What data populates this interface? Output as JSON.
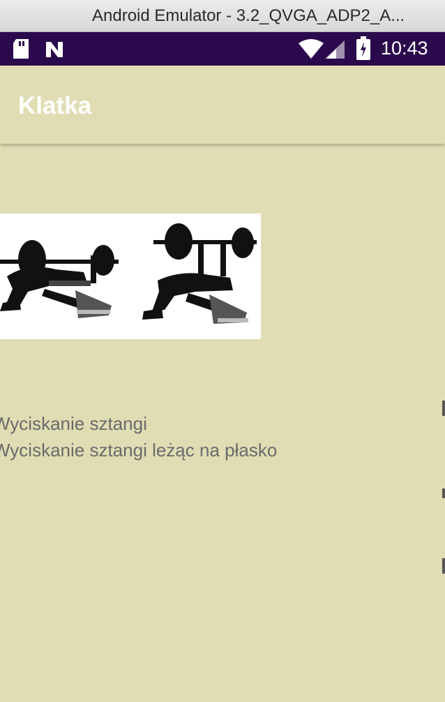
{
  "window": {
    "title": "Android Emulator - 3.2_QVGA_ADP2_A..."
  },
  "status_bar": {
    "time": "10:43",
    "icons": [
      "sd-card-icon",
      "n-logo-icon",
      "wifi-icon",
      "cell-signal-icon",
      "battery-icon"
    ]
  },
  "app_bar": {
    "title": "Klatka"
  },
  "exercise": {
    "name": "Wyciskanie sztangi",
    "description": "Wyciskanie sztangi leżąc na płasko",
    "image": "bench-press-illustration"
  },
  "colors": {
    "background": "#e0ddb4",
    "status_bar": "#2a0a4c",
    "app_bar_title": "#ffffff",
    "text": "#6b6b6b"
  }
}
